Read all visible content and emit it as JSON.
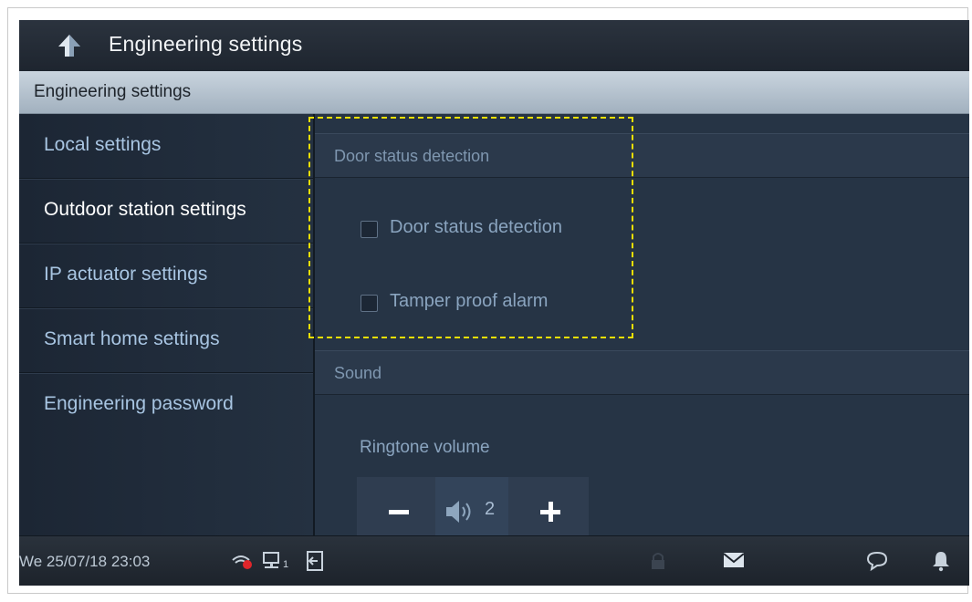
{
  "header": {
    "title": "Engineering settings",
    "back_icon": "back-arrow-icon"
  },
  "breadcrumb": {
    "label": "Engineering settings"
  },
  "sidebar": {
    "items": [
      {
        "label": "Local settings",
        "active": false
      },
      {
        "label": "Outdoor station settings",
        "active": true
      },
      {
        "label": "IP actuator settings",
        "active": false
      },
      {
        "label": "Smart home settings",
        "active": false
      },
      {
        "label": "Engineering password",
        "active": false
      }
    ]
  },
  "panel": {
    "door_section": {
      "heading": "Door status detection",
      "options": [
        {
          "label": "Door status detection",
          "checked": false
        },
        {
          "label": "Tamper proof alarm",
          "checked": false
        }
      ]
    },
    "sound_section": {
      "heading": "Sound",
      "ringtone_label": "Ringtone volume",
      "volume_value": "2"
    }
  },
  "statusbar": {
    "datetime": "We 25/07/18  23:03",
    "network_index": "1",
    "icons": [
      "wifi-alert-icon",
      "network-icon",
      "logout-icon",
      "lock-icon",
      "mail-icon",
      "chat-icon",
      "bell-icon"
    ]
  },
  "colors": {
    "highlight": "#f0e000",
    "alert_dot": "#e0262b",
    "accent_text": "#a8c5e2"
  }
}
